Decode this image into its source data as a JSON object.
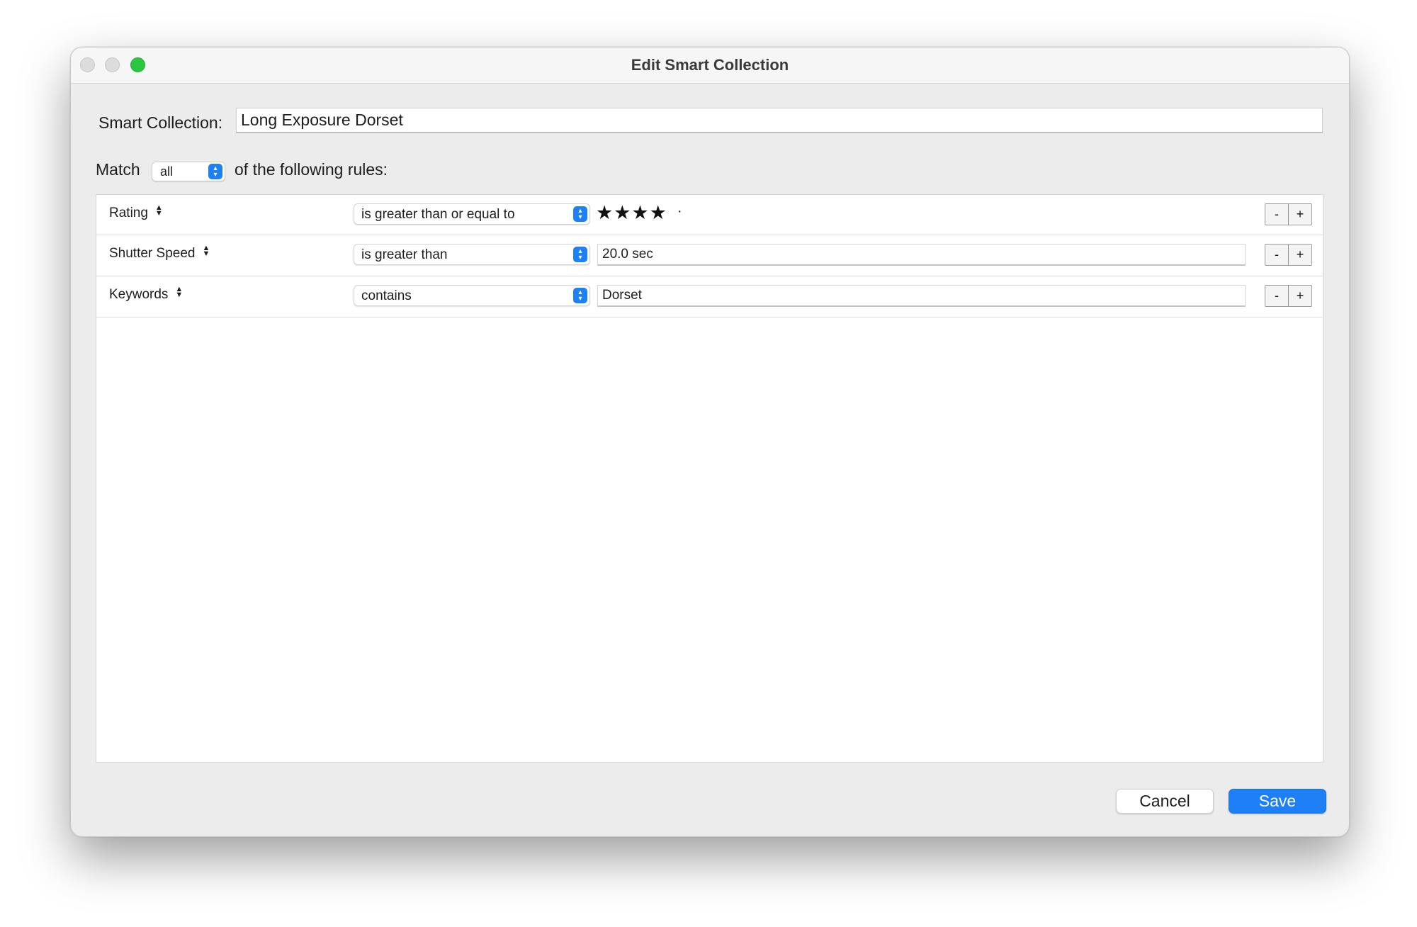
{
  "window": {
    "title": "Edit Smart Collection"
  },
  "name_field": {
    "label": "Smart Collection:",
    "value": "Long Exposure Dorset"
  },
  "match": {
    "prefix": "Match",
    "selected": "all",
    "suffix": "of the following rules:"
  },
  "rules": [
    {
      "field": "Rating",
      "operator": "is greater than or equal to",
      "value_type": "stars",
      "stars_value": 4,
      "stars_display": "★★★★",
      "stars_trailing": "·"
    },
    {
      "field": "Shutter Speed",
      "operator": "is greater than",
      "value_type": "text",
      "value": "20.0 sec"
    },
    {
      "field": "Keywords",
      "operator": "contains",
      "value_type": "text",
      "value": "Dorset"
    }
  ],
  "row_buttons": {
    "remove_label": "-",
    "add_label": "+"
  },
  "footer": {
    "cancel_label": "Cancel",
    "save_label": "Save"
  },
  "colors": {
    "accent": "#1e80f6",
    "zoom_button": "#2ac840"
  }
}
